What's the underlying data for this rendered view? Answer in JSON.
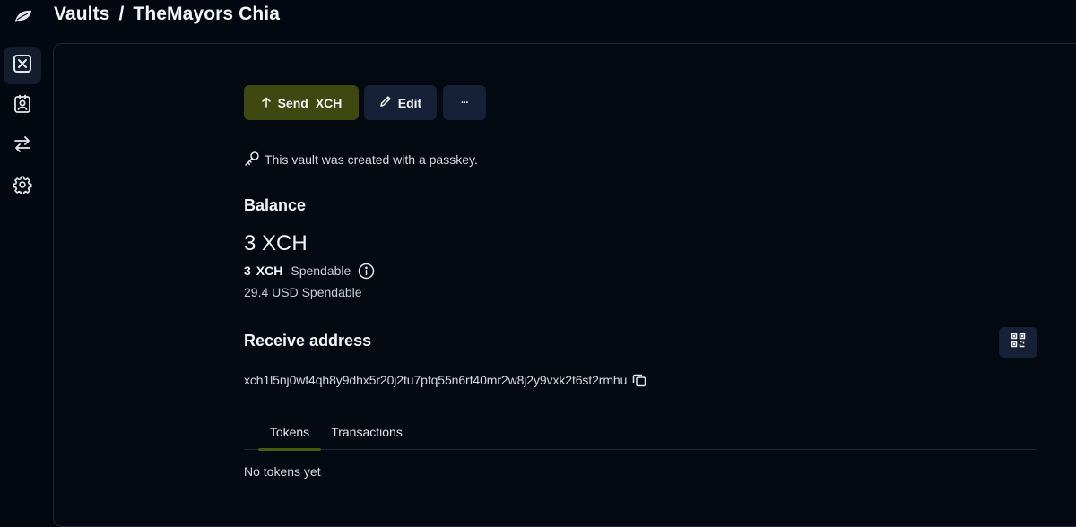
{
  "header": {
    "breadcrumb_root": "Vaults",
    "separator": "/",
    "vault_name": "TheMayors Chia"
  },
  "sidebar": {
    "items": [
      {
        "icon": "vault-x-icon",
        "active": true
      },
      {
        "icon": "contacts-icon",
        "active": false
      },
      {
        "icon": "swap-arrows-icon",
        "active": false
      },
      {
        "icon": "gear-icon",
        "active": false
      }
    ]
  },
  "actions": {
    "send_label": "Send",
    "send_unit": "XCH",
    "edit_label": "Edit",
    "more_label": "···"
  },
  "passkey_note": "This vault was created with a passkey.",
  "balance": {
    "title": "Balance",
    "total": "3 XCH",
    "spendable_amount": "3",
    "spendable_unit": "XCH",
    "spendable_label": "Spendable",
    "usd_line": "29.4 USD Spendable"
  },
  "receive": {
    "title": "Receive address",
    "address": "xch1l5nj0wf4qh8y9dhx5r20j2tu7pfq55n6rf40mr2w8j2y9vxk2t6st2rmhu"
  },
  "tabs": [
    {
      "label": "Tokens",
      "active": true
    },
    {
      "label": "Transactions",
      "active": false
    }
  ],
  "tokens_empty": "No tokens yet",
  "colors": {
    "background": "#040810",
    "send_button": "#3f4810",
    "secondary_button": "#162036",
    "tab_indicator": "#4b5a12"
  }
}
